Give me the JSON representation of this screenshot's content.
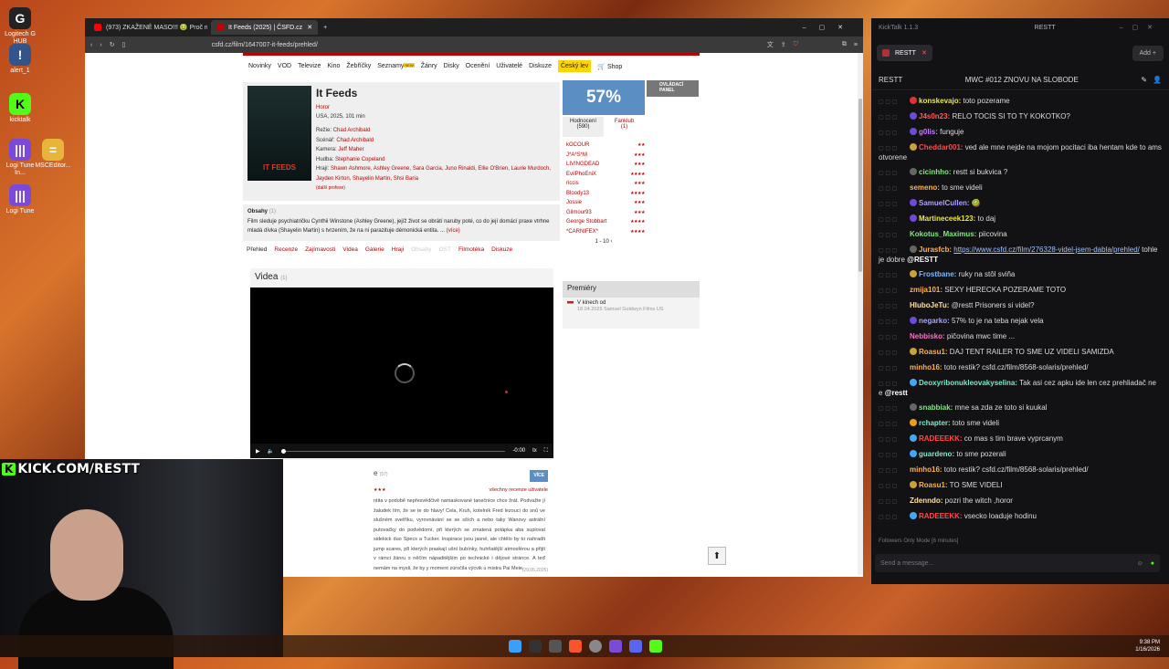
{
  "desktop": {
    "icons": [
      {
        "label": "Logitech G HUB",
        "glyph": "G"
      },
      {
        "label": "alert_1",
        "glyph": "!"
      },
      {
        "label": "kicktalk",
        "glyph": "K"
      },
      {
        "label": "Logi Tune In...",
        "glyph": "|||"
      },
      {
        "label": "MSCEditor...",
        "glyph": "="
      },
      {
        "label": "Logi Tune",
        "glyph": "|||"
      }
    ]
  },
  "browser": {
    "tabs": [
      {
        "title": "(973) ZKAŽENÉ MASO!!! 🤢 Proč mám",
        "active": false,
        "color": "#ff0000"
      },
      {
        "title": "It Feeds (2025) | ČSFD.cz",
        "active": true,
        "color": "#ba0305"
      }
    ],
    "url": "csfd.cz/film/1647007-it-feeds/prehled/",
    "site": {
      "nav": [
        "Novinky",
        "VOD",
        "Televize",
        "Kino",
        "Žebříčky",
        "Seznamy",
        "Žánry",
        "Disky",
        "Ocenění",
        "Uživatelé",
        "Diskuze"
      ],
      "new_badge": "NEW",
      "nav_highlight": "Český lev",
      "shop": "🛒 Shop",
      "film": {
        "title": "It Feeds",
        "genre": "Horor",
        "origin": "USA, 2025, 101 min",
        "rezie_label": "Režie:",
        "rezie": "Chad Archibald",
        "scenar_label": "Scénář:",
        "scenar": "Chad Archibald",
        "kamera_label": "Kamera:",
        "kamera": "Jeff Maher",
        "hudba_label": "Hudba:",
        "hudba": "Stephanie Copeland",
        "hraji_label": "Hrají:",
        "hraji": "Shawn Ashmore, Ashley Greene, Sara Garcia, Juno Rinaldi, Ellie O'Brien, Laurie Murdoch, Jayden Kirton, Shayelin Martin, Shsi Baria",
        "more_profiles": "(další profese)",
        "poster_text": "IT FEEDS"
      },
      "obsah": {
        "label": "Obsahy",
        "count": "(1)",
        "text": "Film sleduje psychiatričku Cynthii Winstone (Ashley Greene), jejíž život se obrátí naruby poté, co do její domácí praxe vtrhne mladá dívka (Shayelin Martin) s tvrzením, že na ni parazituje démonická entita. ...",
        "more": "(více)"
      },
      "subtabs": [
        {
          "label": "Přehled",
          "state": "current"
        },
        {
          "label": "Recenze",
          "state": "link"
        },
        {
          "label": "Zajímavosti",
          "state": "link"
        },
        {
          "label": "Videa",
          "state": "link"
        },
        {
          "label": "Galerie",
          "state": "link"
        },
        {
          "label": "Hraji",
          "state": "link"
        },
        {
          "label": "Obsahy",
          "state": "disabled"
        },
        {
          "label": "OST",
          "state": "disabled"
        },
        {
          "label": "Filmotéka",
          "state": "link"
        },
        {
          "label": "Diskuze",
          "state": "link"
        }
      ],
      "videa": {
        "label": "Videa",
        "count": "(1)",
        "time": "-0:00",
        "tx": "tx"
      },
      "recenze": {
        "label_suffix": "e",
        "count": "(57)",
        "btn": "VÍCE",
        "all_link": "všechny recenze uživatele",
        "text": "ntita v podobě nepřesvědčivě namaskované tanečnice chce žrát. Podvažte jí žaludek tím, že se te do hlavy! Cela, Kruh, kotelník Fred lezoucí do snů ve slušném svetříku, vyrovnávání se se sších a nebo taky Wanovy astrální putovačky do podvědomí, při kterých se zmatená potápka aba suplovat sidekick duo Specs a Tucker. Inspirace jsou jasné, ale chtělo by to nahradit jump scares, při kterých praskají ušní bubínky, huhňatější atmosférou a přijít v rámci žánru s něčím nápaditějším po technické i dějové stránce. A teď nemám na mysli, že by y moment zúročila výcvik u mistra Pai Meie.",
        "date": "(29.05.2025)"
      },
      "rating": {
        "percent": "57%",
        "ctrl_panel": "OVLÁDACÍ PANEL",
        "tab1": "Hodnocení",
        "tab1_count": "(590)",
        "tab2": "Fanklub",
        "tab2_count": "(1)",
        "raters": [
          {
            "name": "kOCOUR",
            "stars": 2
          },
          {
            "name": "J*A*S*M",
            "stars": 3
          },
          {
            "name": "LIVINGDEAD",
            "stars": 3
          },
          {
            "name": "EvilPhoEniX",
            "stars": 4
          },
          {
            "name": "riccis",
            "stars": 3
          },
          {
            "name": "Bloody13",
            "stars": 4
          },
          {
            "name": "Jossie",
            "stars": 3
          },
          {
            "name": "Gilmour93",
            "stars": 3
          },
          {
            "name": "George Stobbart",
            "stars": 4
          },
          {
            "name": "*CARNIFEX*",
            "stars": 4
          }
        ],
        "pager": "1 - 10"
      },
      "premiery": {
        "label": "Premiéry",
        "line1": "V kinech od",
        "line2": "18.04.2025 Samuel Goldwyn Films US"
      }
    }
  },
  "webcam": {
    "banner_k": "K",
    "banner_text": "KICK.COM/RESTT"
  },
  "kicktalk": {
    "app_title": "KickTalk 1.1.3",
    "window_label": "RESTT",
    "channel_tab": "RESTT",
    "add_btn": "Add +",
    "channel_name": "RESTT",
    "stream_title": "MWC #012 ZNOVU NA SLOBODE",
    "messages": [
      {
        "user": "konskevajo:",
        "color": "#e8e84a",
        "badge": "#d33",
        "text": "toto pozerame"
      },
      {
        "user": "J4s0n23:",
        "color": "#ff5a5a",
        "badge": "#6b4bd8",
        "text": "RELO TOCIS SI TO TY KOKOTKO?"
      },
      {
        "user": "g0lis:",
        "color": "#c77dff",
        "badge": "#6b4bd8",
        "text": "funguje"
      },
      {
        "user": "Cheddar001:",
        "color": "#ff4a4a",
        "badge": "#c9a23a",
        "text": "ved ale mne nejde na mojom pocitaci iba hentam kde to ams otvorene"
      },
      {
        "user": "cicinhho:",
        "color": "#7ee87e",
        "badge": "#666",
        "text": "restt si bukvica ?"
      },
      {
        "user": "semeno:",
        "color": "#ffb347",
        "badge": "",
        "text": "to sme videli"
      },
      {
        "user": "SamuelCullen:",
        "color": "#a9a2ff",
        "badge": "#6b4bd8",
        "text": "🥝"
      },
      {
        "user": "Martineceek123:",
        "color": "#e8e84a",
        "badge": "#6b4bd8",
        "text": "to daj"
      },
      {
        "user": "Kokotus_Maximus:",
        "color": "#7ee87e",
        "badge": "",
        "text": "piicovina"
      },
      {
        "user": "Jurasfcb:",
        "color": "#ffb347",
        "badge": "#666",
        "link": "https://www.csfd.cz/film/276328-videl-jsem-dabla/prehled/",
        "text": "tohle je dobre",
        "mention": "@RESTT"
      },
      {
        "user": "Frostbane:",
        "color": "#7ab8ff",
        "badge": "#c9a23a",
        "text": "ruky na stôl sviňa"
      },
      {
        "user": "zmija101:",
        "color": "#ffb347",
        "badge": "",
        "text": "SEXY HERECKA POZERAME TOTO"
      },
      {
        "user": "HluboJeTu:",
        "color": "#ffe0a0",
        "badge": "",
        "text": "@restt Prisoners si videl?"
      },
      {
        "user": "negarko:",
        "color": "#a9a2ff",
        "badge": "#6b4bd8",
        "text": "57% to je na teba nejak vela"
      },
      {
        "user": "Nebbisko:",
        "color": "#ff6ec7",
        "badge": "",
        "text": "pičovina mwc time ..."
      },
      {
        "user": "Roasu1:",
        "color": "#ffb347",
        "badge": "#c9a23a",
        "text": "DAJ TENT RAILER TO SME UZ VIDELI SAMIZDA"
      },
      {
        "user": "minho16:",
        "color": "#ffb347",
        "badge": "",
        "text": "toto restik? csfd.cz/film/8568-solaris/prehled/"
      },
      {
        "user": "Deoxyribonukleovakyselina:",
        "color": "#7ee8c8",
        "badge": "#3fa9f5",
        "text": "Tak asi cez apku ide len cez prehliadač ne e",
        "mention": "@restt"
      },
      {
        "user": "snabbiak:",
        "color": "#7ee87e",
        "badge": "#666",
        "text": "mne sa zda ze toto si kuukal"
      },
      {
        "user": "rchapter:",
        "color": "#7ee8c8",
        "badge": "#e8a01a",
        "text": "toto sme videli"
      },
      {
        "user": "RADEEEKK:",
        "color": "#ff4a4a",
        "badge": "#3fa9f5",
        "text": "co mas s tim brave vyprcanym"
      },
      {
        "user": "guardeno:",
        "color": "#7ee8c8",
        "badge": "#3fa9f5",
        "text": "to sme pozerali"
      },
      {
        "user": "minho16:",
        "color": "#ffb347",
        "badge": "",
        "text": "toto restik? csfd.cz/film/8568-solaris/prehled/"
      },
      {
        "user": "Roasu1:",
        "color": "#ffb347",
        "badge": "#c9a23a",
        "text": "TO SME VIDELI"
      },
      {
        "user": "Zdenndo:",
        "color": "#ffe0a0",
        "badge": "",
        "text": "pozri the witch ,horor"
      },
      {
        "user": "RADEEEKK:",
        "color": "#ff4a4a",
        "badge": "#3fa9f5",
        "text": "vsecko loaduje hodinu"
      }
    ],
    "followers_mode": "Followers Only Mode [6 minutes]",
    "input_placeholder": "Send a message..."
  },
  "taskbar": {
    "time": "9:38 PM",
    "date": "1/16/2026"
  }
}
